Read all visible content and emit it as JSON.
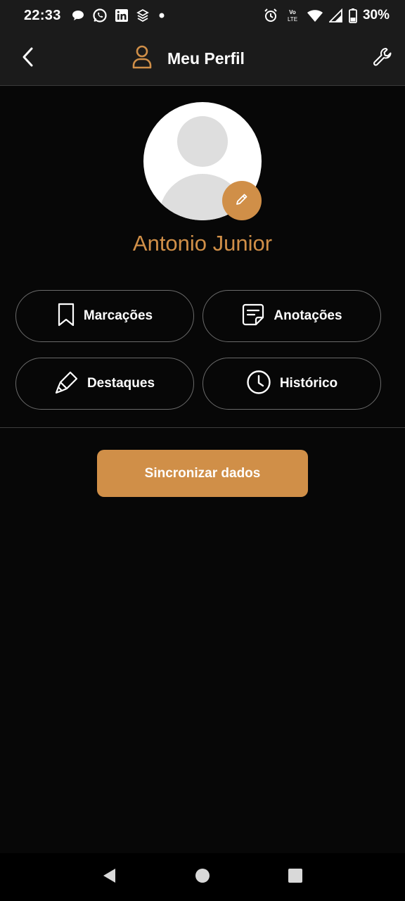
{
  "status_bar": {
    "time": "22:33",
    "battery": "30%",
    "left_icons": [
      "chat-bubble-icon",
      "whatsapp-icon",
      "linkedin-icon",
      "stack-icon",
      "dot-icon"
    ],
    "right_icons": [
      "alarm-icon",
      "volte-icon",
      "wifi-icon",
      "signal-icon",
      "battery-icon"
    ],
    "volte_label": "Vo LTE"
  },
  "app_bar": {
    "title": "Meu Perfil",
    "back_icon": "chevron-left-icon",
    "title_icon": "person-icon",
    "settings_icon": "wrench-icon"
  },
  "profile": {
    "name": "Antonio Junior",
    "edit_icon": "pencil-icon"
  },
  "options": [
    {
      "label": "Marcações",
      "icon": "bookmark-icon"
    },
    {
      "label": "Anotações",
      "icon": "note-icon"
    },
    {
      "label": "Destaques",
      "icon": "highlighter-icon"
    },
    {
      "label": "Histórico",
      "icon": "clock-icon"
    }
  ],
  "sync_button": {
    "label": "Sincronizar dados"
  },
  "colors": {
    "accent": "#d08f48",
    "background": "#070707",
    "bar": "#1b1b1b",
    "border": "#6a6a6a"
  },
  "nav_bar": {
    "icons": [
      "back-triangle-icon",
      "home-circle-icon",
      "recents-square-icon"
    ]
  }
}
